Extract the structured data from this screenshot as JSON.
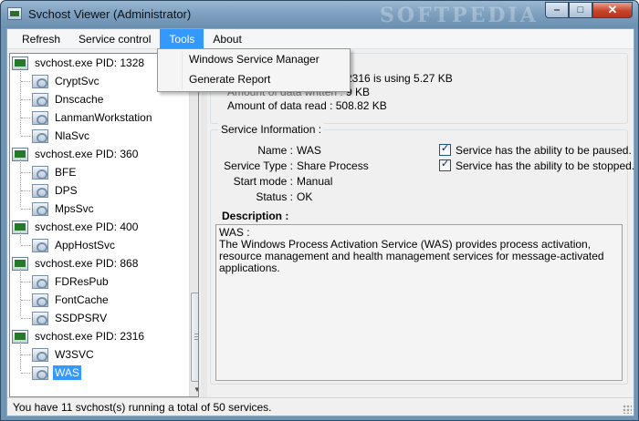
{
  "window": {
    "title": "Svchost Viewer (Administrator)",
    "watermark": "SOFTPEDIA",
    "minimize_glyph": "‒",
    "maximize_glyph": "□",
    "close_glyph": "✕"
  },
  "menu": {
    "items": [
      "Refresh",
      "Service control",
      "Tools",
      "About"
    ],
    "active": "Tools",
    "tools_dropdown": [
      "Windows Service Manager",
      "Generate Report"
    ]
  },
  "tree": {
    "processes": [
      {
        "label": "svchost.exe PID: 1328",
        "services": [
          "CryptSvc",
          "Dnscache",
          "LanmanWorkstation",
          "NlaSvc"
        ]
      },
      {
        "label": "svchost.exe PID: 360",
        "services": [
          "BFE",
          "DPS",
          "MpsSvc"
        ]
      },
      {
        "label": "svchost.exe PID: 400",
        "services": [
          "AppHostSvc"
        ]
      },
      {
        "label": "svchost.exe PID: 868",
        "services": [
          "FDResPub",
          "FontCache",
          "SSDPSRV"
        ]
      },
      {
        "label": "svchost.exe PID: 2316",
        "services": [
          "W3SVC",
          "WAS"
        ]
      }
    ],
    "selected": "WAS",
    "scroll_up": "▲",
    "scroll_down": "▼"
  },
  "process_panel": {
    "line1": "2316 is using 5.27 KB",
    "line2_prefix": "Amount of data written :",
    "line2_value": "9 KB",
    "line3": "Amount of data read : 508.82 KB"
  },
  "service_info": {
    "legend": "Service Information :",
    "name_label": "Name :",
    "name_value": "WAS",
    "type_label": "Service Type :",
    "type_value": "Share Process",
    "start_label": "Start mode :",
    "start_value": "Manual",
    "status_label": "Status :",
    "status_value": "OK",
    "can_pause_label": "Service has the ability to be paused.",
    "can_pause": true,
    "can_stop_label": "Service has the ability to be stopped.",
    "can_stop": true,
    "description_heading": "Description :",
    "description_text": "WAS :\nThe Windows Process Activation Service (WAS) provides process activation, resource management and health management services for message-activated applications."
  },
  "statusbar": {
    "text": "You have 11 svchost(s) running a total of 50 services."
  }
}
